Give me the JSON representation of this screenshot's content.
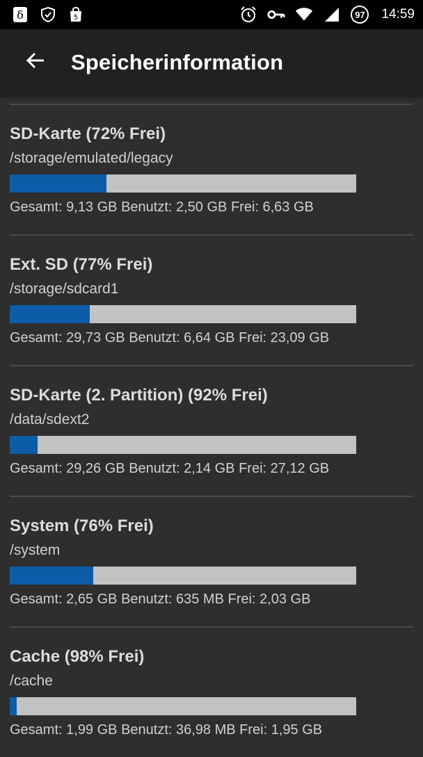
{
  "status_bar": {
    "time": "14:59",
    "battery_level": "97",
    "left_icons": [
      "delta-icon",
      "shield-check-icon",
      "shopping-bag-icon"
    ],
    "right_icons": [
      "alarm-icon",
      "key-icon",
      "wifi-icon",
      "signal-icon"
    ]
  },
  "appbar": {
    "title": "Speicherinformation",
    "back_icon": "arrow-back-icon"
  },
  "colors": {
    "used_fill": "#0d5ca8",
    "bar_track": "#c2c2c2",
    "background": "#2e2e2e",
    "appbar": "#212121"
  },
  "storage": [
    {
      "title": "SD-Karte (72% Frei)",
      "path": "/storage/emulated/legacy",
      "used_fraction": 0.28,
      "stats": "Gesamt: 9,13 GB Benutzt: 2,50 GB Frei: 6,63 GB"
    },
    {
      "title": "Ext. SD (77% Frei)",
      "path": "/storage/sdcard1",
      "used_fraction": 0.23,
      "stats": "Gesamt: 29,73 GB Benutzt: 6,64 GB Frei: 23,09 GB"
    },
    {
      "title": "SD-Karte (2. Partition) (92% Frei)",
      "path": "/data/sdext2",
      "used_fraction": 0.08,
      "stats": "Gesamt: 29,26 GB Benutzt: 2,14 GB Frei: 27,12 GB"
    },
    {
      "title": "System (76% Frei)",
      "path": "/system",
      "used_fraction": 0.24,
      "stats": "Gesamt: 2,65 GB Benutzt: 635 MB Frei: 2,03 GB"
    },
    {
      "title": "Cache (98% Frei)",
      "path": "/cache",
      "used_fraction": 0.02,
      "stats": "Gesamt: 1,99 GB Benutzt: 36,98 MB Frei: 1,95 GB"
    }
  ]
}
